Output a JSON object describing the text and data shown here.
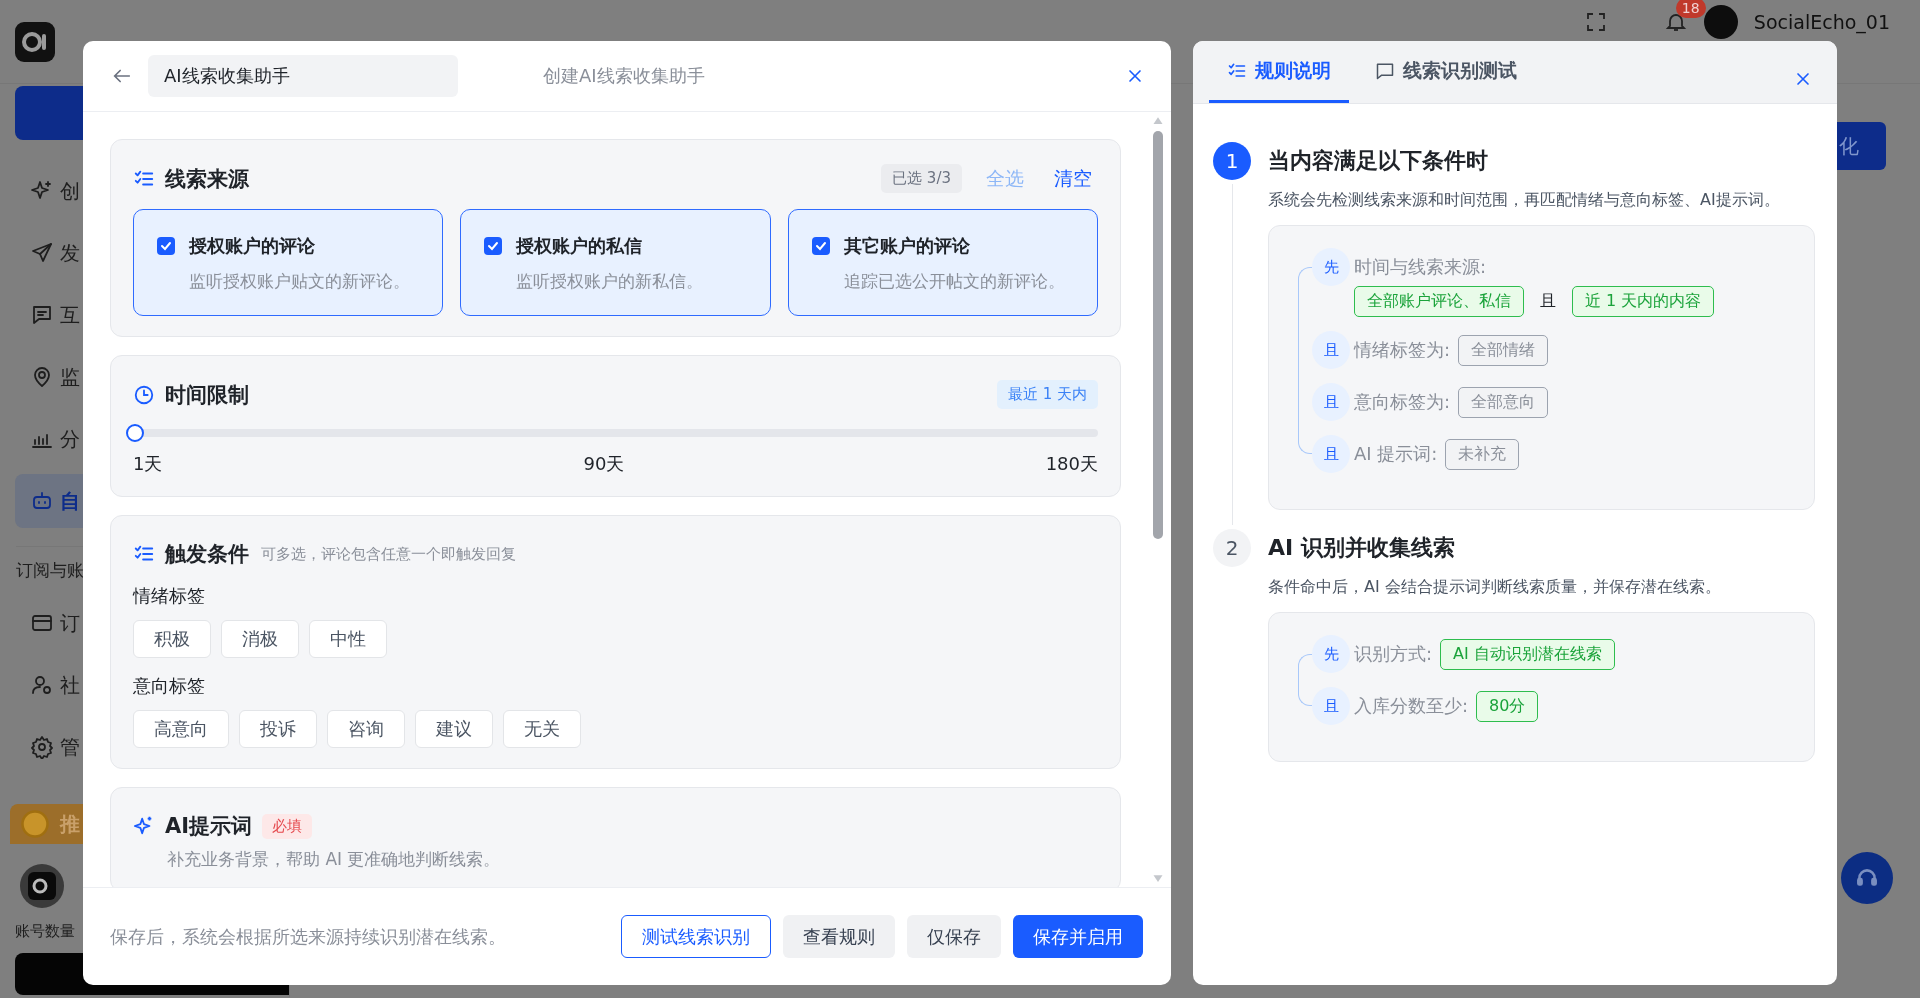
{
  "app_background": {
    "sidebar": {
      "items": [
        {
          "label": "创",
          "selected": false
        },
        {
          "label": "发",
          "selected": false
        },
        {
          "label": "互",
          "selected": false
        },
        {
          "label": "监",
          "selected": false
        },
        {
          "label": "分",
          "selected": false
        },
        {
          "label": "自",
          "selected": true
        }
      ],
      "section_label": "订阅与账",
      "section_items": [
        {
          "label": "订",
          "selected": false
        },
        {
          "label": "社",
          "selected": false
        },
        {
          "label": "管",
          "selected": false
        }
      ],
      "promo_label": "推",
      "account_label": "账号数量"
    },
    "user": {
      "name": "SocialEcho_01",
      "notification_count": "18"
    },
    "action_button": "化"
  },
  "modal": {
    "name_value": "AI线索收集助手",
    "title": "创建AI线索收集助手",
    "source": {
      "title": "线索来源",
      "selected_count": "已选 3/3",
      "select_all": {
        "label": "全选",
        "disabled": true
      },
      "clear": {
        "label": "清空",
        "disabled": false
      },
      "options": [
        {
          "label": "授权账户的评论",
          "description": "监听授权账户贴文的新评论。",
          "checked": true
        },
        {
          "label": "授权账户的私信",
          "description": "监听授权账户的新私信。",
          "checked": true
        },
        {
          "label": "其它账户的评论",
          "description": "追踪已选公开帖文的新评论。",
          "checked": true
        }
      ]
    },
    "time_limit": {
      "title": "时间限制",
      "badge": "最近 1 天内",
      "level": 0,
      "ticks": [
        "1天",
        "90天",
        "180天"
      ]
    },
    "trigger": {
      "title": "触发条件",
      "hint": "可多选，评论包含任意一个即触发回复",
      "groups": [
        {
          "label": "情绪标签",
          "tags": [
            {
              "label": "积极",
              "selected": false
            },
            {
              "label": "消极",
              "selected": false
            },
            {
              "label": "中性",
              "selected": false
            }
          ]
        },
        {
          "label": "意向标签",
          "tags": [
            {
              "label": "高意向",
              "selected": false
            },
            {
              "label": "投诉",
              "selected": false
            },
            {
              "label": "咨询",
              "selected": false
            },
            {
              "label": "建议",
              "selected": false
            },
            {
              "label": "无关",
              "selected": false
            }
          ]
        }
      ]
    },
    "prompt": {
      "title": "AI提示词",
      "required_badge": "必填",
      "description": "补充业务背景，帮助 AI 更准确地判断线索。"
    },
    "footer": {
      "note": "保存后，系统会根据所选来源持续识别潜在线索。",
      "buttons": [
        {
          "label": "测试线索识别",
          "kind": "outline"
        },
        {
          "label": "查看规则",
          "kind": "secondary"
        },
        {
          "label": "仅保存",
          "kind": "secondary"
        },
        {
          "label": "保存并启用",
          "kind": "primary"
        }
      ]
    }
  },
  "rules_panel": {
    "tabs": [
      {
        "label": "规则说明",
        "selected": true
      },
      {
        "label": "线索识别测试",
        "selected": false
      }
    ],
    "steps": [
      {
        "number": "1",
        "active": true,
        "title": "当内容满足以下条件时",
        "description": "系统会先检测线索来源和时间范围，再匹配情绪与意向标签、AI提示词。",
        "conditions": [
          {
            "prefix": "先",
            "label": "时间与线索来源:",
            "values_on_new_line": true,
            "values": [
              {
                "text": "全部账户评论、私信",
                "kind": "green"
              },
              {
                "text": "且",
                "kind": "joiner"
              },
              {
                "text": "近 1 天内的内容",
                "kind": "green"
              }
            ]
          },
          {
            "prefix": "且",
            "label": "情绪标签为:",
            "values_on_new_line": false,
            "values": [
              {
                "text": "全部情绪",
                "kind": "grey"
              }
            ]
          },
          {
            "prefix": "且",
            "label": "意向标签为:",
            "values_on_new_line": false,
            "values": [
              {
                "text": "全部意向",
                "kind": "grey"
              }
            ]
          },
          {
            "prefix": "且",
            "label": "AI 提示词:",
            "values_on_new_line": false,
            "values": [
              {
                "text": "未补充",
                "kind": "grey"
              }
            ]
          }
        ]
      },
      {
        "number": "2",
        "active": false,
        "title": "AI 识别并收集线索",
        "description": "条件命中后，AI 会结合提示词判断线索质量，并保存潜在线索。",
        "conditions": [
          {
            "prefix": "先",
            "label": "识别方式:",
            "values_on_new_line": false,
            "values": [
              {
                "text": "AI 自动识别潜在线索",
                "kind": "green"
              }
            ]
          },
          {
            "prefix": "且",
            "label": "入库分数至少:",
            "values_on_new_line": false,
            "values": [
              {
                "text": "80分",
                "kind": "green"
              }
            ]
          }
        ]
      }
    ]
  }
}
